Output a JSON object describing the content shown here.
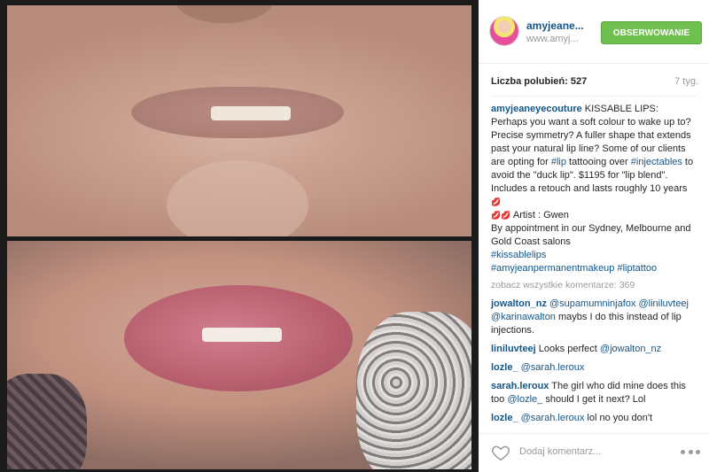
{
  "post": {
    "image_alt": "Lip tattoo before and after"
  },
  "header": {
    "username": "amyjeane...",
    "website": "www.amyj...",
    "follow_label": "OBSERWOWANIE"
  },
  "stats": {
    "likes_label": "Liczba polubień: 527",
    "age": "7 tyg."
  },
  "caption": {
    "username": "amyjeaneyecouture",
    "part1": " KISSABLE LIPS: Perhaps you want a soft colour to wake up to? Precise symmetry? A fuller shape that extends past your natural lip line? Some of our clients are opting for ",
    "tag_lip": "#lip",
    "part2": " tattooing over ",
    "tag_injectables": "#injectables",
    "part3": " to avoid the \"duck lip\". $1195 for \"lip blend\". Includes a retouch and lasts roughly 10 years ",
    "emoji1": "💋",
    "emoji2": "💋💋",
    "part4": " Artist : Gwen",
    "part5": "By appointment in our Sydney, Melbourne and Gold Coast salons",
    "tag_kissable": "#kissablelips",
    "tag_amyjean": "#amyjeanpermanentmakeup",
    "tag_liptattoo": "#liptattoo"
  },
  "view_all_comments": "zobacz wszystkie komentarze: 369",
  "comments": [
    {
      "user": "jowalton_nz",
      "mention1": "@supamumninjafox",
      "mention2": "@liniluvteej",
      "mention3": "@karinawalton",
      "text": " maybs I do this instead of lip injections."
    },
    {
      "user": "liniluvteej",
      "text": " Looks perfect ",
      "mention1": "@jowalton_nz"
    },
    {
      "user": "lozle_",
      "mention1": "@sarah.leroux"
    },
    {
      "user": "sarah.leroux",
      "text1": " The girl who did mine does this too ",
      "mention1": "@lozle_",
      "text2": " should I get it next? Lol"
    },
    {
      "user": "lozle_",
      "mention1": "@sarah.leroux",
      "text": " lol no you don't"
    }
  ],
  "footer": {
    "add_comment_placeholder": "Dodaj komentarz...",
    "like_icon": "heart-outline-icon",
    "more_icon": "more-options-icon"
  },
  "colors": {
    "link": "#125688",
    "follow_button": "#70c050",
    "muted": "#999999"
  }
}
